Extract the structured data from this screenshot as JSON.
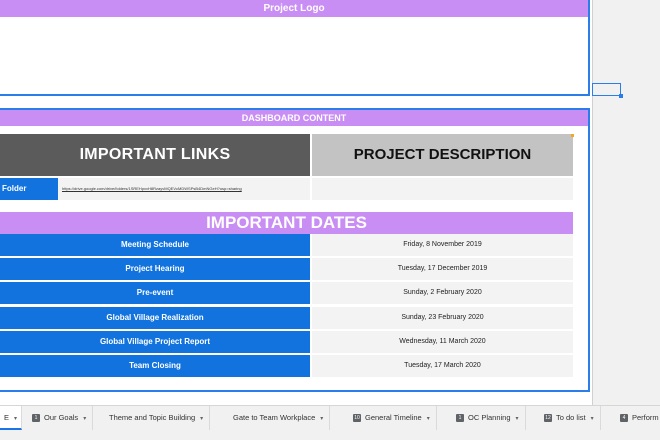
{
  "logo_section": {
    "title": "Project Logo"
  },
  "dashboard": {
    "title": "DASHBOARD CONTENT",
    "links_header": "IMPORTANT LINKS",
    "description_header": "PROJECT DESCRIPTION",
    "folder_label": "Folder",
    "folder_url": "https://drive.google.com/drive/folders/1SREHpxvH8RzayvMQEVcMDWSPsB4DmNGeH?usp=sharing",
    "dates_header": "IMPORTANT DATES",
    "dates": [
      {
        "name": "Meeting Schedule",
        "date": "Friday, 8 November 2019"
      },
      {
        "name": "Project Hearing",
        "date": "Tuesday, 17 December 2019"
      },
      {
        "name": "Pre-event",
        "date": "Sunday, 2 February 2020"
      },
      {
        "name": "Global Village Realization",
        "date": "Sunday, 23 February 2020"
      },
      {
        "name": "Global Village Project Report",
        "date": "Wednesday, 11 March 2020"
      },
      {
        "name": "Team Closing",
        "date": "Tuesday, 17 March 2020"
      }
    ]
  },
  "sheet_tabs": [
    {
      "label": "E",
      "icon": "",
      "active": true
    },
    {
      "label": "Our Goals",
      "icon": "1"
    },
    {
      "label": "Theme and Topic Building",
      "icon": ""
    },
    {
      "label": "Gate to Team Workplace",
      "icon": ""
    },
    {
      "label": "General Timeline",
      "icon": "10"
    },
    {
      "label": "OC Planning",
      "icon": "1"
    },
    {
      "label": "To do list",
      "icon": "12"
    },
    {
      "label": "Perform",
      "icon": "4"
    }
  ],
  "colors": {
    "accent_purple": "#c98ef4",
    "blue": "#1273de",
    "dark_gray": "#5b5b5b",
    "light_gray": "#c3c3c3"
  }
}
